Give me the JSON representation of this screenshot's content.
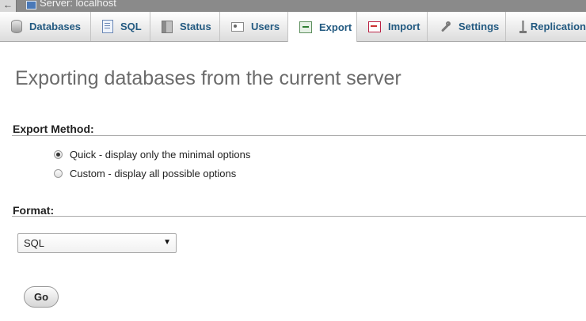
{
  "topbar": {
    "back_glyph": "←",
    "title": "Server: localhost",
    "icon": "server-icon"
  },
  "tabs": [
    {
      "label": "Databases",
      "icon": "databases-icon"
    },
    {
      "label": "SQL",
      "icon": "sql-icon"
    },
    {
      "label": "Status",
      "icon": "status-icon"
    },
    {
      "label": "Users",
      "icon": "users-icon"
    },
    {
      "label": "Export",
      "icon": "export-icon",
      "active": true
    },
    {
      "label": "Import",
      "icon": "import-icon"
    },
    {
      "label": "Settings",
      "icon": "settings-icon"
    },
    {
      "label": "Replication",
      "icon": "replication-icon"
    }
  ],
  "page": {
    "title": "Exporting databases from the current server"
  },
  "export_method": {
    "heading": "Export Method:",
    "options": [
      {
        "label": "Quick - display only the minimal options",
        "checked": true
      },
      {
        "label": "Custom - display all possible options",
        "checked": false
      }
    ]
  },
  "format": {
    "heading": "Format:",
    "selected": "SQL",
    "arrow": "▼"
  },
  "go_label": "Go",
  "colors": {
    "tab_text": "#235a81",
    "title_text": "#6b6b6b",
    "topbar_bg": "#8a8a8a"
  }
}
